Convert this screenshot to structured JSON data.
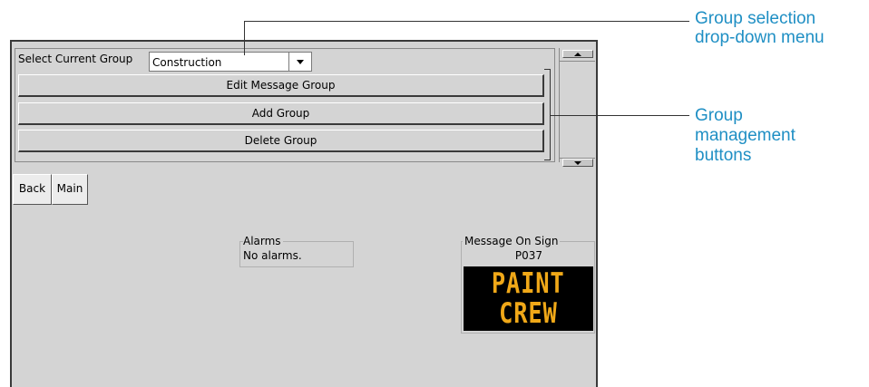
{
  "group_select": {
    "label": "Select Current Group",
    "selected_value": "Construction"
  },
  "buttons": {
    "edit": "Edit Message Group",
    "add": "Add Group",
    "delete": "Delete Group"
  },
  "nav": {
    "back": "Back",
    "main": "Main"
  },
  "alarms": {
    "title": "Alarms",
    "text": "No alarms."
  },
  "sign": {
    "title": "Message On Sign",
    "id": "P037",
    "lines": [
      "PAINT",
      "CREW"
    ],
    "text_color": "#f0a818",
    "background_color": "#000000"
  },
  "callouts": {
    "dropdown": [
      "Group selection",
      "drop-down menu"
    ],
    "buttons": [
      "Group",
      "management",
      "buttons"
    ],
    "color": "#1f8fc4"
  },
  "icons": {
    "dropdown_arrow": "chevron-down-icon",
    "scroll_up": "scroll-up-arrow-icon",
    "scroll_down": "scroll-down-arrow-icon"
  }
}
